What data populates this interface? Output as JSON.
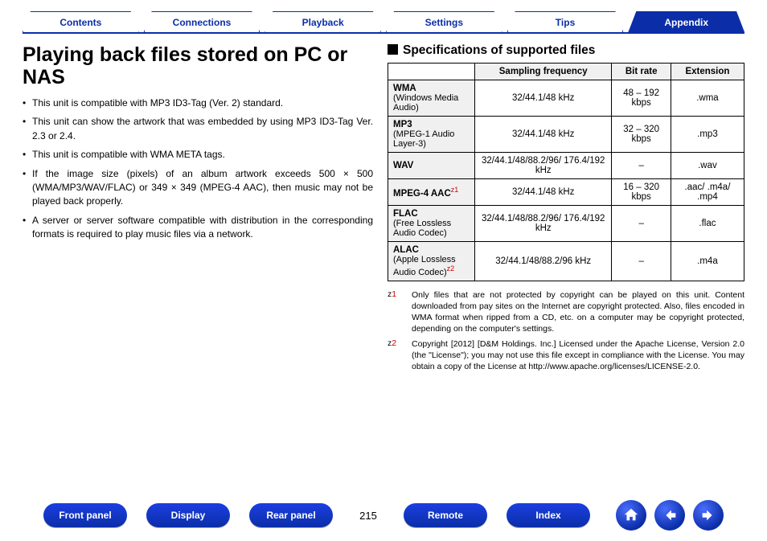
{
  "tabs": {
    "items": [
      "Contents",
      "Connections",
      "Playback",
      "Settings",
      "Tips",
      "Appendix"
    ],
    "activeIndex": 5
  },
  "left": {
    "heading": "Playing back files stored on PC or NAS",
    "bullets": [
      "This unit is compatible with MP3 ID3-Tag (Ver. 2) standard.",
      "This unit can show the artwork that was embedded by using MP3 ID3-Tag Ver. 2.3 or 2.4.",
      "This unit is compatible with WMA META tags.",
      "If the image size (pixels) of an album artwork exceeds 500 × 500 (WMA/MP3/WAV/FLAC) or 349 × 349 (MPEG-4 AAC), then music may not be played back properly.",
      "A server or server software compatible with distribution in the corresponding formats is required to play music files via a network."
    ]
  },
  "right": {
    "heading": "Specifications of supported files",
    "columns": [
      "Sampling frequency",
      "Bit rate",
      "Extension"
    ],
    "rows": [
      {
        "name": "WMA",
        "sub": "(Windows Media Audio)",
        "sup": "",
        "freq": "32/44.1/48 kHz",
        "bitrate": "48 – 192 kbps",
        "ext": ".wma"
      },
      {
        "name": "MP3",
        "sub": "(MPEG-1 Audio Layer-3)",
        "sup": "",
        "freq": "32/44.1/48 kHz",
        "bitrate": "32 – 320 kbps",
        "ext": ".mp3"
      },
      {
        "name": "WAV",
        "sub": "",
        "sup": "",
        "freq": "32/44.1/48/88.2/96/ 176.4/192 kHz",
        "bitrate": "–",
        "ext": ".wav"
      },
      {
        "name": "MPEG-4 AAC",
        "sub": "",
        "sup": "z1",
        "freq": "32/44.1/48 kHz",
        "bitrate": "16 – 320 kbps",
        "ext": ".aac/ .m4a/ .mp4"
      },
      {
        "name": "FLAC",
        "sub": "(Free Lossless Audio Codec)",
        "sup": "",
        "freq": "32/44.1/48/88.2/96/ 176.4/192 kHz",
        "bitrate": "–",
        "ext": ".flac"
      },
      {
        "name": "ALAC",
        "sub": "(Apple Lossless Audio Codec)",
        "sup": "z2",
        "freq": "32/44.1/48/88.2/96 kHz",
        "bitrate": "–",
        "ext": ".m4a"
      }
    ],
    "footnotes": [
      {
        "mark": "z1",
        "text": "Only files that are not protected by copyright can be played on this unit. Content downloaded from pay sites on the Internet are copyright protected. Also, files encoded in WMA format when ripped from a CD, etc. on a computer may be copyright protected, depending on the computer's settings."
      },
      {
        "mark": "z2",
        "text": "Copyright [2012] [D&M Holdings. Inc.] Licensed under the Apache License, Version 2.0 (the \"License\"); you may not use this file except in compliance with the License. You may obtain a copy of the License at http://www.apache.org/licenses/LICENSE-2.0."
      }
    ],
    "license_url": "http://www.apache.org/licenses/LICENSE-2.0"
  },
  "bottom": {
    "buttons_left": [
      "Front panel",
      "Display",
      "Rear panel"
    ],
    "page_number": "215",
    "buttons_right": [
      "Remote",
      "Index"
    ]
  }
}
